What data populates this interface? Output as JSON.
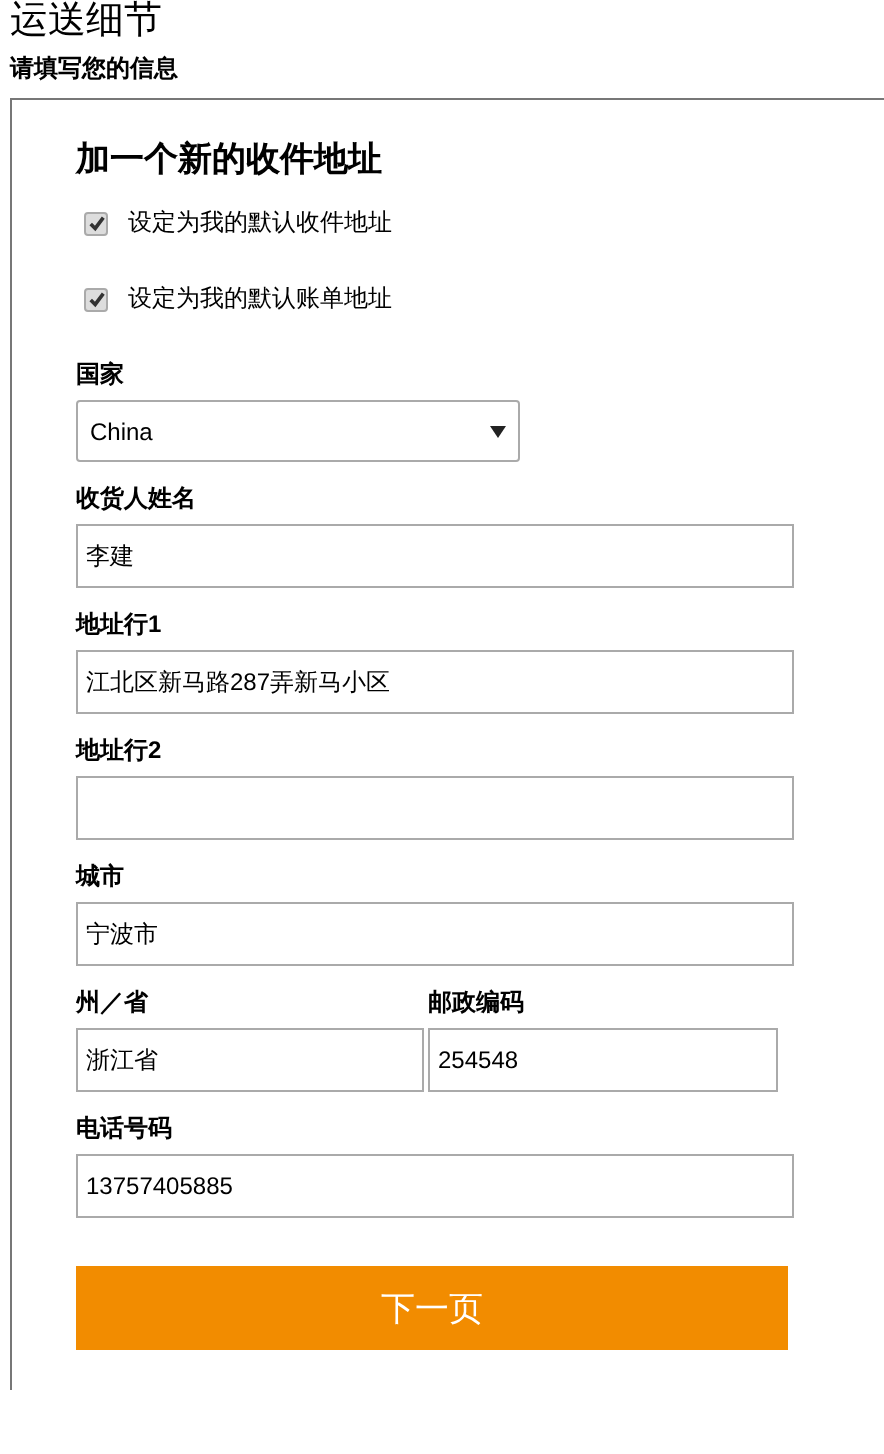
{
  "page_title": "运送细节",
  "subtitle": "请填写您的信息",
  "form": {
    "heading": "加一个新的收件地址",
    "checkboxes": [
      {
        "label": "设定为我的默认收件地址",
        "checked": true
      },
      {
        "label": "设定为我的默认账单地址",
        "checked": true
      }
    ],
    "rows": [
      {
        "kind": "select",
        "fields": [
          {
            "label": "国家",
            "value": "China"
          }
        ]
      },
      {
        "kind": "text",
        "fields": [
          {
            "label": "收货人姓名",
            "value": "李建"
          }
        ]
      },
      {
        "kind": "text",
        "fields": [
          {
            "label": "地址行1",
            "value": "江北区新马路287弄新马小区"
          }
        ]
      },
      {
        "kind": "text",
        "fields": [
          {
            "label": "地址行2"
          }
        ]
      },
      {
        "kind": "text",
        "fields": [
          {
            "label": "城市",
            "value": "宁波市"
          }
        ]
      },
      {
        "kind": "pair",
        "fields": [
          {
            "label": "州／省",
            "value": "浙江省"
          },
          {
            "label": "邮政编码",
            "value": "254548"
          }
        ]
      },
      {
        "kind": "text",
        "fields": [
          {
            "label": "电话号码",
            "value": "13757405885"
          }
        ]
      }
    ],
    "submit": "下一页"
  }
}
